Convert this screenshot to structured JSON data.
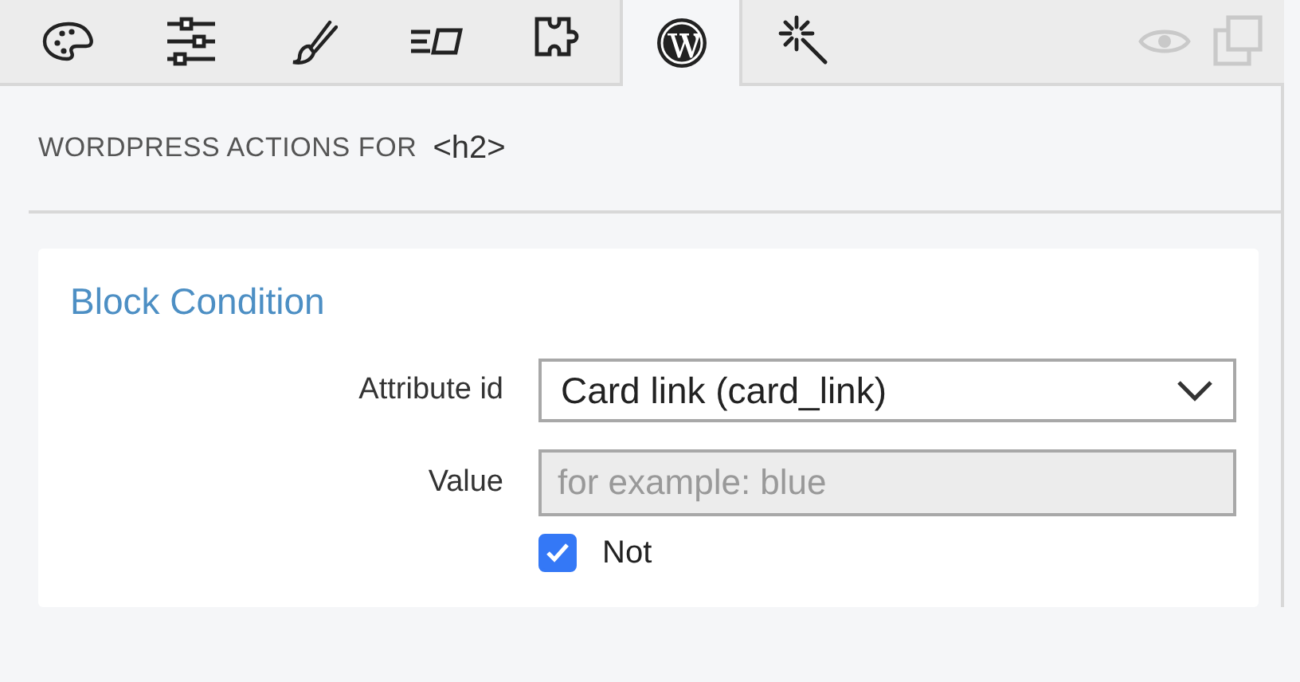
{
  "tabs": [
    {
      "kind": "palette",
      "selected": false
    },
    {
      "kind": "sliders",
      "selected": false
    },
    {
      "kind": "brush",
      "selected": false
    },
    {
      "kind": "text",
      "selected": false
    },
    {
      "kind": "puzzle",
      "selected": false
    },
    {
      "kind": "wordpress",
      "selected": true
    },
    {
      "kind": "wand",
      "selected": false
    }
  ],
  "header": {
    "title": "WORDPRESS ACTIONS FOR",
    "element": "<h2>"
  },
  "card": {
    "title": "Block Condition",
    "fields": [
      {
        "kind": "select",
        "label": "Attribute id",
        "value": "Card link (card_link)"
      },
      {
        "kind": "text",
        "label": "Value",
        "placeholder": "for example: blue"
      }
    ],
    "checkbox": {
      "label": "Not",
      "checked": true
    }
  }
}
